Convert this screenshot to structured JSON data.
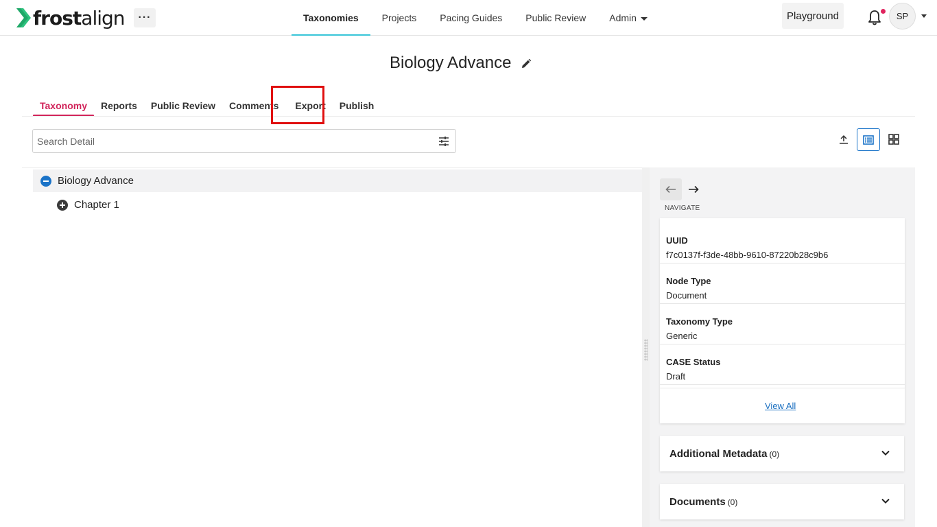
{
  "brand": {
    "name_bold": "frost",
    "name_light": "align",
    "accent": "#2ec27e"
  },
  "header": {
    "more_label": "···",
    "nav": [
      {
        "label": "Taxonomies",
        "active": true
      },
      {
        "label": "Projects"
      },
      {
        "label": "Pacing Guides"
      },
      {
        "label": "Public Review"
      },
      {
        "label": "Admin"
      }
    ],
    "playground_label": "Playground",
    "avatar_initials": "SP"
  },
  "page": {
    "title": "Biology Advance"
  },
  "tabs": [
    {
      "label": "Taxonomy",
      "active": true
    },
    {
      "label": "Reports"
    },
    {
      "label": "Public Review"
    },
    {
      "label": "Comments"
    },
    {
      "label": "Export"
    },
    {
      "label": "Publish"
    }
  ],
  "search": {
    "placeholder": "Search Detail",
    "value": ""
  },
  "tree": {
    "root": {
      "label": "Biology Advance"
    },
    "children": [
      {
        "label": "Chapter 1"
      }
    ]
  },
  "detail": {
    "navigate_label": "NAVIGATE",
    "fields": [
      {
        "key": "UUID",
        "value": "f7c0137f-f3de-48bb-9610-87220b28c9b6"
      },
      {
        "key": "Node Type",
        "value": "Document"
      },
      {
        "key": "Taxonomy Type",
        "value": "Generic"
      },
      {
        "key": "CASE Status",
        "value": "Draft"
      }
    ],
    "view_all_label": "View All",
    "accordions": [
      {
        "title": "Additional Metadata",
        "count": "(0)"
      },
      {
        "title": "Documents",
        "count": "(0)"
      }
    ]
  },
  "colors": {
    "accent_tab": "#d1245a",
    "nav_underline": "#38c5d8",
    "link": "#1a6fc0",
    "highlight": "#e01010"
  }
}
